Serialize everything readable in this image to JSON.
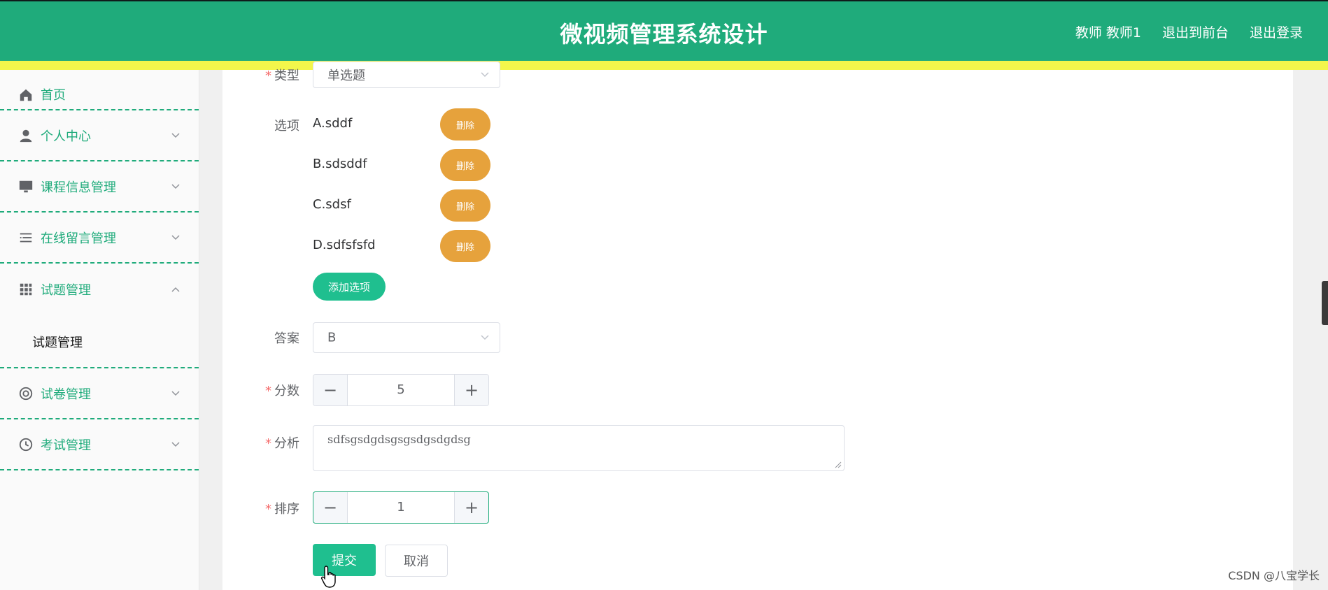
{
  "header": {
    "title": "微视频管理系统设计",
    "links": [
      "教师 教师1",
      "退出到前台",
      "退出登录"
    ]
  },
  "sidebar": {
    "items": [
      {
        "label": "首页",
        "icon": "home-icon"
      },
      {
        "label": "个人中心",
        "icon": "user-icon",
        "expanded": false
      },
      {
        "label": "课程信息管理",
        "icon": "monitor-icon",
        "expanded": false
      },
      {
        "label": "在线留言管理",
        "icon": "list-icon",
        "expanded": false
      },
      {
        "label": "试题管理",
        "icon": "grid-icon",
        "expanded": true
      },
      {
        "label": "试卷管理",
        "icon": "lifebuoy-icon",
        "expanded": false
      },
      {
        "label": "考试管理",
        "icon": "clock-icon",
        "expanded": false
      }
    ],
    "submenu_label": "试题管理"
  },
  "form": {
    "type": {
      "label": "类型",
      "value": "单选题"
    },
    "options": {
      "label": "选项",
      "items": [
        "A.sddf",
        "B.sdsddf",
        "C.sdsf",
        "D.sdfsfsfd"
      ],
      "delete_label": "删除",
      "add_label": "添加选项"
    },
    "answer": {
      "label": "答案",
      "value": "B"
    },
    "score": {
      "label": "分数",
      "value": "5",
      "minus": "−",
      "plus": "+"
    },
    "analysis": {
      "label": "分析",
      "value": "sdfsgsdgdsgsgsdgsdgdsg"
    },
    "order": {
      "label": "排序",
      "value": "1",
      "minus": "−",
      "plus": "+"
    },
    "submit_label": "提交",
    "cancel_label": "取消"
  },
  "watermark": "CSDN @八宝学长",
  "colors": {
    "primary": "#1fab7b",
    "accent_strip": "#f3f64b",
    "danger_btn": "#e6a23c",
    "required": "#f56c6c"
  }
}
